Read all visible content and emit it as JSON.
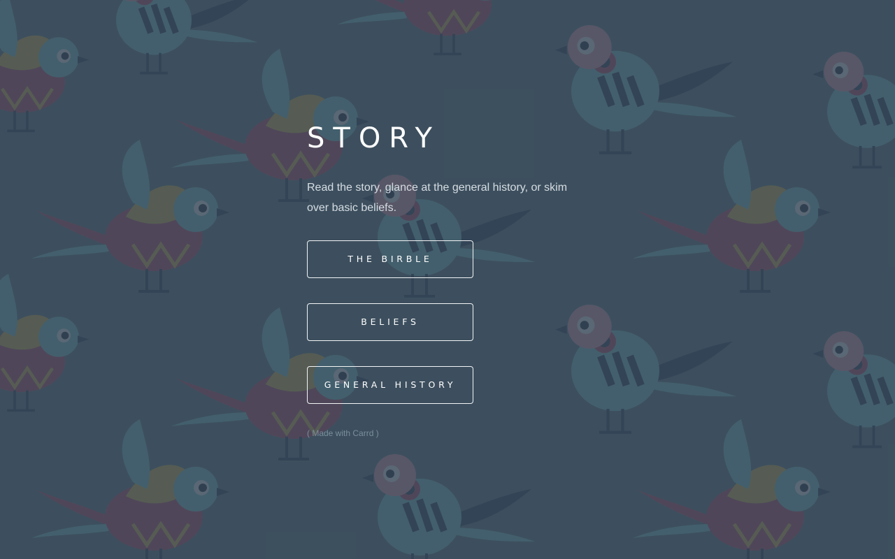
{
  "hero": {
    "title": "STORY",
    "intro": "Read the story, glance at the general history, or skim over basic beliefs."
  },
  "buttons": [
    {
      "label": "THE BIRBLE"
    },
    {
      "label": "BELIEFS"
    },
    {
      "label": "GENERAL HISTORY"
    }
  ],
  "footer": {
    "credit": "( Made with Carrd )"
  },
  "colors": {
    "background_overlay": "#364655",
    "text_primary": "#ffffff",
    "text_secondary": "#d6dde3",
    "credit_text": "#7a8e9b",
    "bird_palette": [
      "#c44d6b",
      "#e5c24a",
      "#7fd0d6",
      "#2a3d5c",
      "#f0a5b8"
    ]
  },
  "background": {
    "pattern": "folk-art bird illustration pattern"
  }
}
